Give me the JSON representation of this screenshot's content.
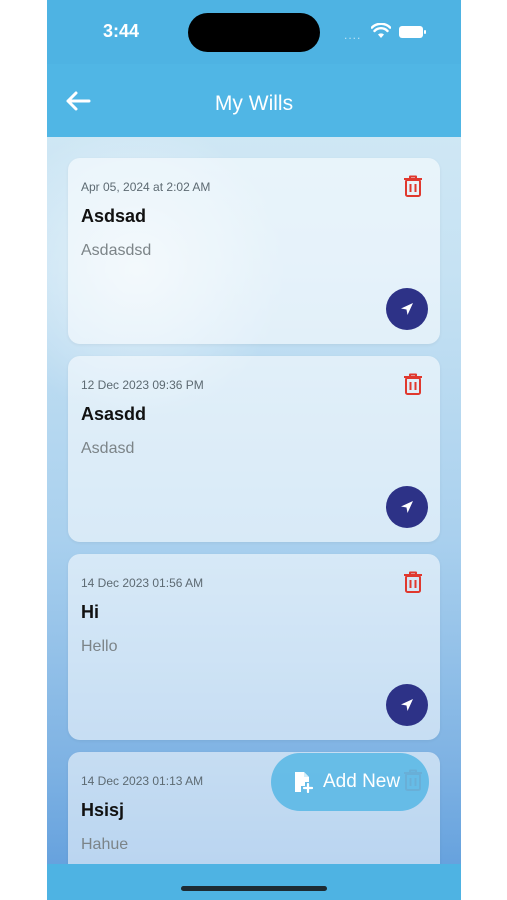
{
  "status_bar": {
    "time": "3:44",
    "signal": "....",
    "icons": [
      "wifi-icon",
      "battery-icon"
    ]
  },
  "header": {
    "title": "My Wills",
    "back_icon": "arrow-left-icon"
  },
  "wills": [
    {
      "date": "Apr 05, 2024 at 2:02 AM",
      "title": "Asdsad",
      "description": "Asdasdsd"
    },
    {
      "date": "12 Dec 2023 09:36 PM",
      "title": "Asasdd",
      "description": "Asdasd"
    },
    {
      "date": "14 Dec 2023 01:56 AM",
      "title": "Hi",
      "description": "Hello"
    },
    {
      "date": "14 Dec 2023 01:13 AM",
      "title": "Hsisj",
      "description": "Hahue"
    }
  ],
  "fab": {
    "label": "Add New",
    "icon": "add-file-icon"
  },
  "colors": {
    "header": "#50b6e5",
    "delete": "#e0382e",
    "navigate": "#2d3287",
    "fab": "#5ebae6"
  }
}
